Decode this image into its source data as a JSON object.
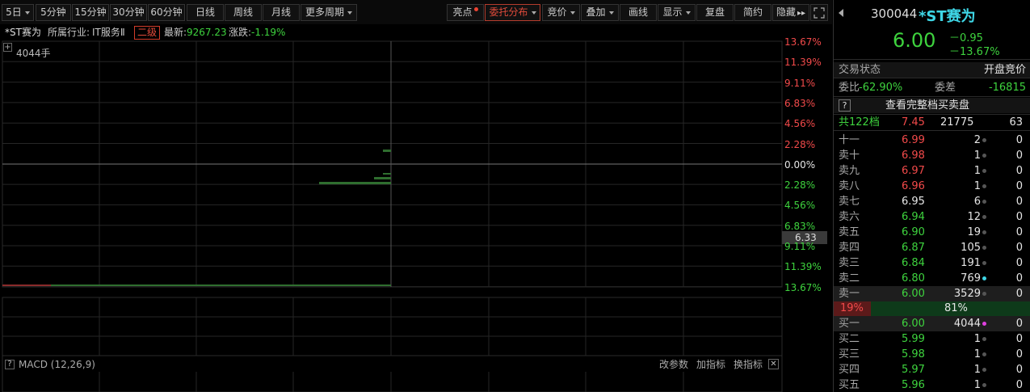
{
  "toolbar": {
    "five_day": "5日",
    "min5": "5分钟",
    "min15": "15分钟",
    "min30": "30分钟",
    "min60": "60分钟",
    "daily": "日线",
    "weekly": "周线",
    "monthly": "月线",
    "more_periods": "更多周期",
    "highlight": "亮点",
    "order_distribution": "委托分布",
    "auction": "竞价",
    "overlay": "叠加",
    "draw_line": "画线",
    "display": "显示",
    "review": "复盘",
    "simple": "简约",
    "hide": "隐藏",
    "hide_arrows": "▸▸",
    "fullscreen_icon": "fullscreen-icon"
  },
  "info": {
    "stock_name": "*ST赛为",
    "industry_label": "所属行业:",
    "industry": "IT服务Ⅱ",
    "level": "二级",
    "latest_label": "最新:",
    "latest_value": "9267.23",
    "change_label": "涨跌:",
    "change_value": "-1.19%"
  },
  "chart": {
    "volume_label": "4044手",
    "price_marker": "6.33",
    "right_axis": [
      "13.67%",
      "11.39%",
      "9.11%",
      "6.83%",
      "4.56%",
      "2.28%",
      "0.00%",
      "2.28%",
      "4.56%",
      "6.83%",
      "9.11%",
      "11.39%",
      "13.67%"
    ],
    "colors": {
      "up": "#f24a4a",
      "down": "#3ed33e",
      "zero": "#e6e6e6"
    }
  },
  "macd": {
    "help": "?",
    "label": "MACD (12,26,9)",
    "change_params": "改参数",
    "add_indicator": "加指标",
    "switch_indicator": "换指标",
    "close_icon": "close-icon"
  },
  "orderbook": {
    "code": "300044",
    "name": "*ST赛为",
    "price": "6.00",
    "change": "－0.95",
    "change_pct": "－13.67%",
    "trade_status_label": "交易状态",
    "trade_status": "开盘竞价",
    "ratio_label": "委比",
    "ratio": "-62.90%",
    "diff_label": "委差",
    "diff": "-16815",
    "full_book": "查看完整档买卖盘",
    "total_label": "共122档",
    "total_price": "7.45",
    "total_vol": "21775",
    "total_cnt": "63",
    "asks": [
      {
        "label": "十一",
        "price": "6.99",
        "vol": "2",
        "chg": "0"
      },
      {
        "label": "卖十",
        "price": "6.98",
        "vol": "1",
        "chg": "0"
      },
      {
        "label": "卖九",
        "price": "6.97",
        "vol": "1",
        "chg": "0"
      },
      {
        "label": "卖八",
        "price": "6.96",
        "vol": "1",
        "chg": "0"
      },
      {
        "label": "卖七",
        "price": "6.95",
        "vol": "6",
        "chg": "0"
      },
      {
        "label": "卖六",
        "price": "6.94",
        "vol": "12",
        "chg": "0"
      },
      {
        "label": "卖五",
        "price": "6.90",
        "vol": "19",
        "chg": "0"
      },
      {
        "label": "卖四",
        "price": "6.87",
        "vol": "105",
        "chg": "0"
      },
      {
        "label": "卖三",
        "price": "6.84",
        "vol": "191",
        "chg": "0"
      },
      {
        "label": "卖二",
        "price": "6.80",
        "vol": "769",
        "chg": "0"
      },
      {
        "label": "卖一",
        "price": "6.00",
        "vol": "3529",
        "chg": "0"
      }
    ],
    "sell_pct": "19%",
    "buy_pct": "81%",
    "bids": [
      {
        "label": "买一",
        "price": "6.00",
        "vol": "4044",
        "chg": "0"
      },
      {
        "label": "买二",
        "price": "5.99",
        "vol": "1",
        "chg": "0"
      },
      {
        "label": "买三",
        "price": "5.98",
        "vol": "1",
        "chg": "0"
      },
      {
        "label": "买四",
        "price": "5.97",
        "vol": "1",
        "chg": "0"
      },
      {
        "label": "买五",
        "price": "5.96",
        "vol": "1",
        "chg": "0"
      }
    ]
  }
}
